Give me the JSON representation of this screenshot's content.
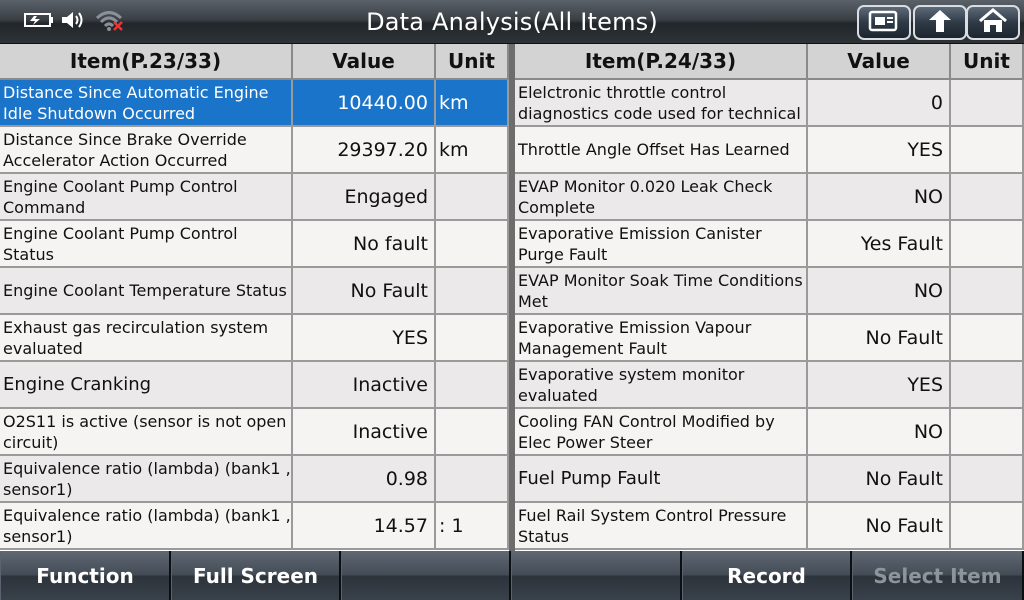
{
  "app": {
    "title": "Data Analysis(All Items)"
  },
  "header_icons": [
    "battery-icon",
    "volume-icon",
    "wifi-icon"
  ],
  "header_buttons": [
    "screenshot-icon",
    "up-arrow-icon",
    "home-icon"
  ],
  "columns": {
    "item_left": "Item(P.23/33)",
    "item_right": "Item(P.24/33)",
    "value": "Value",
    "unit": "Unit"
  },
  "left_rows": [
    {
      "item": "Distance Since Automatic Engine Idle Shutdown Occurred",
      "value": "10440.00",
      "unit": "km"
    },
    {
      "item": "Distance Since Brake Override Accelerator Action Occurred",
      "value": "29397.20",
      "unit": "km"
    },
    {
      "item": "Engine Coolant Pump Control Command",
      "value": "Engaged",
      "unit": ""
    },
    {
      "item": "Engine Coolant Pump Control Status",
      "value": "No fault",
      "unit": ""
    },
    {
      "item": "Engine Coolant Temperature Status",
      "value": "No Fault",
      "unit": ""
    },
    {
      "item": "Exhaust gas recirculation system evaluated",
      "value": "YES",
      "unit": ""
    },
    {
      "item": "Engine Cranking",
      "value": "Inactive",
      "unit": ""
    },
    {
      "item": "O2S11 is active (sensor is not open circuit)",
      "value": "Inactive",
      "unit": ""
    },
    {
      "item": "Equivalence ratio (lambda) (bank1 , sensor1)",
      "value": "0.98",
      "unit": ""
    },
    {
      "item": "Equivalence ratio (lambda) (bank1 , sensor1)",
      "value": "14.57",
      "unit": ": 1"
    }
  ],
  "right_rows": [
    {
      "item": "Elelctronic throttle control diagnostics code used for technical",
      "value": "0",
      "unit": ""
    },
    {
      "item": "Throttle Angle Offset Has Learned",
      "value": "YES",
      "unit": ""
    },
    {
      "item": "EVAP Monitor 0.020 Leak Check Complete",
      "value": "NO",
      "unit": ""
    },
    {
      "item": "Evaporative Emission Canister Purge Fault",
      "value": "Yes Fault",
      "unit": ""
    },
    {
      "item": "EVAP Monitor Soak Time Conditions Met",
      "value": "NO",
      "unit": ""
    },
    {
      "item": "Evaporative Emission Vapour Management Fault",
      "value": "No Fault",
      "unit": ""
    },
    {
      "item": "Evaporative system monitor evaluated",
      "value": "YES",
      "unit": ""
    },
    {
      "item": "Cooling FAN Control Modified by Elec Power Steer",
      "value": "NO",
      "unit": ""
    },
    {
      "item": "Fuel Pump Fault",
      "value": "No Fault",
      "unit": ""
    },
    {
      "item": "Fuel Rail System Control Pressure Status",
      "value": "No Fault",
      "unit": ""
    }
  ],
  "toolbar": {
    "function": "Function",
    "full_screen": "Full Screen",
    "record": "Record",
    "select_item": "Select Item"
  },
  "colors": {
    "selected_row": "#1a74c9",
    "title_bar": "#3b4046"
  }
}
